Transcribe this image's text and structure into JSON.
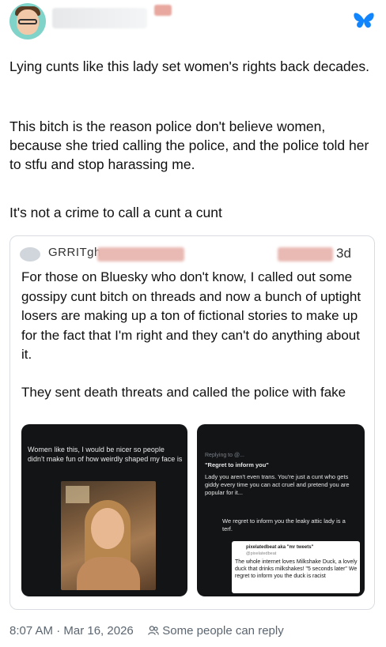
{
  "post": {
    "paragraphs": [
      "Lying cunts like this lady set women's rights back decades.",
      "This bitch is the reason police don't believe women, because she tried calling the police, and the police told her to stfu and stop harassing me.",
      "It's not a crime to call a cunt a cunt"
    ],
    "footer_time": "8:07 AM · Mar 16, 2026",
    "footer_reply": "Some people can reply"
  },
  "quote": {
    "author": "GRRITgh",
    "time": "3d",
    "paragraphs": [
      "For those on Bluesky who don't know, I called out some gossipy cunt bitch on threads and now a bunch of uptight losers are making up a ton of fictional stories to make up for the fact that I'm right and they can't do anything about it.",
      "They sent death threats and called the police with fake"
    ],
    "shot_left": {
      "caption": "Women like this, I would be nicer so people didn't make fun of how weirdly shaped my face is"
    },
    "shot_right": {
      "replying": "Replying to @...",
      "regret": "\"Regret to inform you\"",
      "reply1": "Lady you aren't even trans. You're just a cunt who gets giddy every time you can act cruel and pretend you are popular for it...",
      "reply2": "We regret to inform you the leaky attic lady is a terf.",
      "card_name": "pixelatedbeat aka \"mr tweets\"",
      "card_handle": "@pixelatedbeat",
      "card_text": "The whole internet loves Milkshake Duck, a lovely duck that drinks milkshakes! \"5 seconds later\" We regret to inform you the duck is racist"
    }
  },
  "colors": {
    "bluesky": "#1185fe",
    "text": "#111111",
    "muted": "#5c6670",
    "border": "#d9dde1"
  },
  "icons": [
    "avatar",
    "bluesky-butterfly-icon",
    "people-icon"
  ]
}
